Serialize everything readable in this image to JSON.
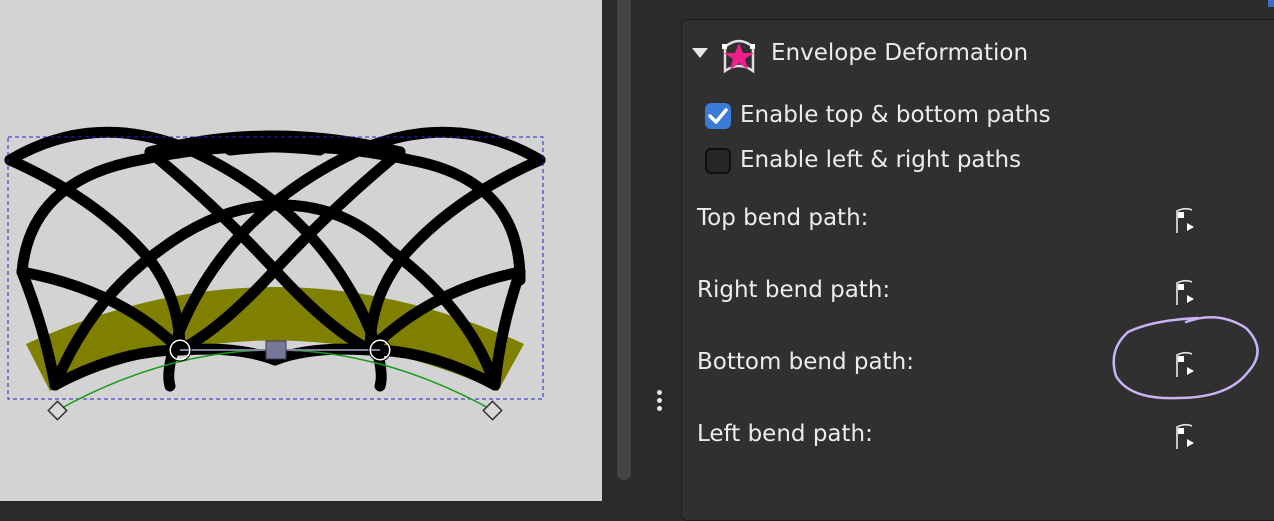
{
  "canvas": {
    "background": "#d3d3d3",
    "fill_color": "#808000",
    "stroke_color": "#000000",
    "bbox_color": "#2222cc",
    "path_color": "#1a9c1a"
  },
  "panel": {
    "effect_title": "Envelope Deformation",
    "effect_icon": "envelope-deformation-icon",
    "checkboxes": [
      {
        "label": "Enable top & bottom paths",
        "checked": true
      },
      {
        "label": "Enable left & right paths",
        "checked": false
      }
    ],
    "paths": [
      {
        "label": "Top bend path:",
        "icon": "edit-on-canvas-icon"
      },
      {
        "label": "Right bend path:",
        "icon": "edit-on-canvas-icon"
      },
      {
        "label": "Bottom bend path:",
        "icon": "edit-on-canvas-icon",
        "annotated": true
      },
      {
        "label": "Left bend path:",
        "icon": "edit-on-canvas-icon"
      }
    ],
    "accent_color": "#3b7bd8",
    "annotation_color": "#c9b3f5"
  }
}
